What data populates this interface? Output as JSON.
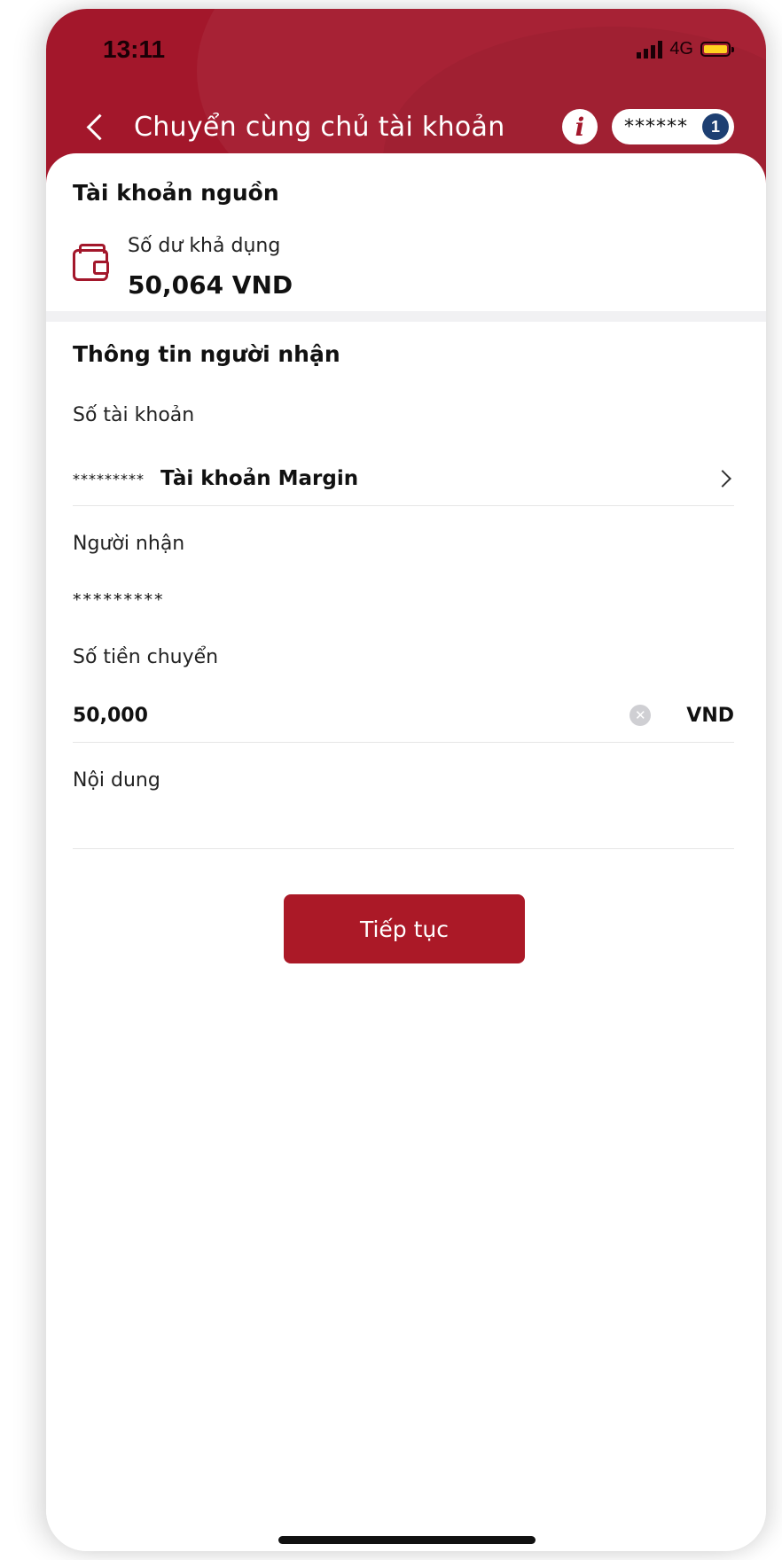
{
  "status_bar": {
    "time": "13:11",
    "network": "4G"
  },
  "header": {
    "title": "Chuyển cùng chủ tài khoản",
    "info_symbol": "i",
    "account_masked": "******",
    "account_count": "1"
  },
  "source": {
    "section_title": "Tài khoản nguồn",
    "balance_label": "Số dư khả dụng",
    "balance_value": "50,064 VND"
  },
  "recipient": {
    "section_title": "Thông tin người nhận",
    "account_number_label": "Số tài khoản",
    "account_number_masked": "*********",
    "account_type": "Tài khoản Margin",
    "receiver_label": "Người nhận",
    "receiver_masked": "*********",
    "amount_label": "Số tiền chuyển",
    "amount_value": "50,000",
    "currency": "VND",
    "content_label": "Nội dung",
    "content_value": ""
  },
  "actions": {
    "continue_label": "Tiếp tục"
  },
  "colors": {
    "brand_red": "#a3172b",
    "badge_blue": "#1d3f72"
  }
}
